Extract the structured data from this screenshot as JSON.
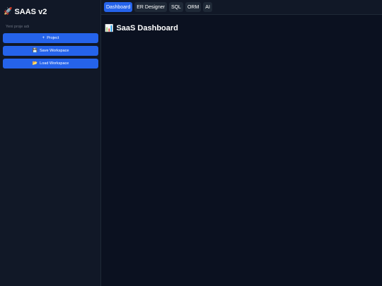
{
  "sidebar": {
    "brand_icon": "🚀",
    "brand_title": "SAAS v2",
    "project_input": {
      "value": "",
      "placeholder": "Yeni proje adı"
    },
    "buttons": [
      {
        "icon": "+",
        "label": "Project"
      },
      {
        "icon": "💾",
        "label": "Save Workspace"
      },
      {
        "icon": "📂",
        "label": "Load Workspace"
      }
    ]
  },
  "tabs": [
    {
      "label": "Dashboard",
      "active": true
    },
    {
      "label": "ER Designer",
      "active": false
    },
    {
      "label": "SQL",
      "active": false
    },
    {
      "label": "ORM",
      "active": false
    },
    {
      "label": "AI",
      "active": false
    }
  ],
  "main": {
    "title_icon": "📊",
    "title": "SaaS Dashboard"
  },
  "colors": {
    "accent": "#2563eb",
    "sidebar_bg": "#111827",
    "main_bg": "#0b1120"
  }
}
